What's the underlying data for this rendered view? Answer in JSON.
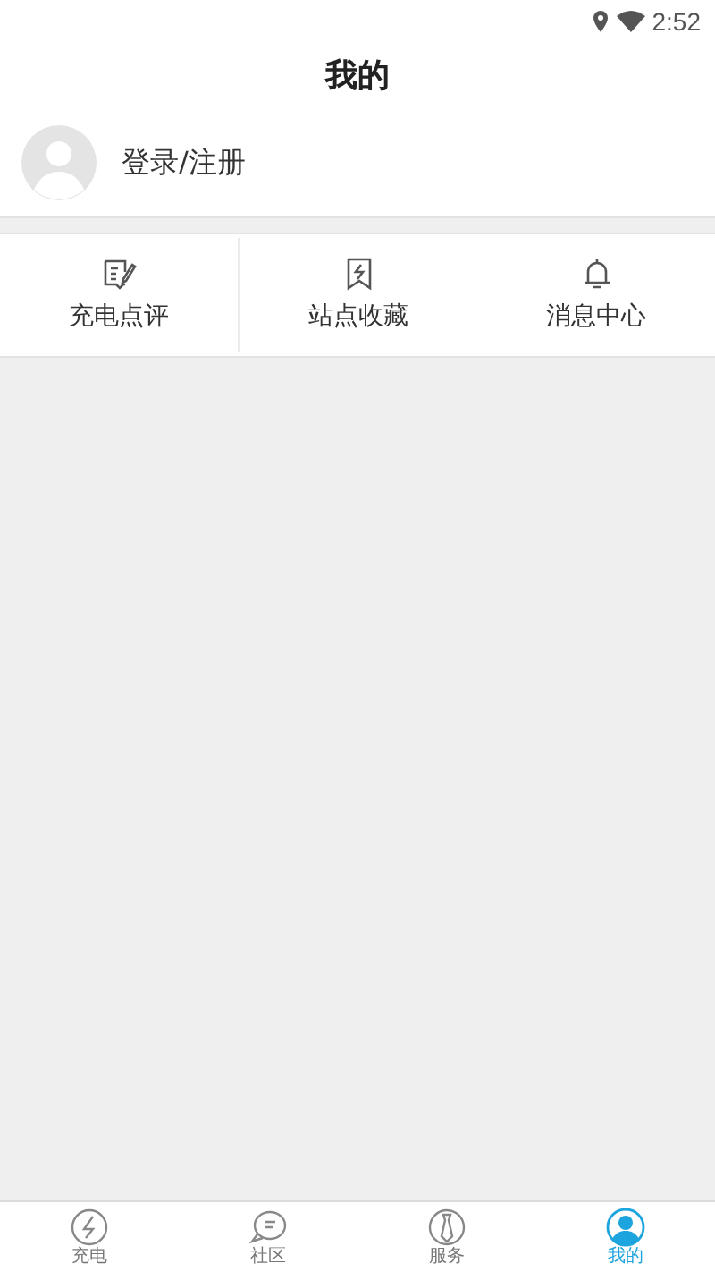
{
  "status_bar": {
    "time": "2:52"
  },
  "header": {
    "title": "我的"
  },
  "profile": {
    "login_label": "登录/注册"
  },
  "shortcuts": [
    {
      "kind": "review",
      "label": "充电点评"
    },
    {
      "kind": "bookmark",
      "label": "站点收藏"
    },
    {
      "kind": "bell",
      "label": "消息中心"
    }
  ],
  "bottom_nav": [
    {
      "kind": "bolt",
      "label": "充电",
      "selected": false
    },
    {
      "kind": "chat",
      "label": "社区",
      "selected": false
    },
    {
      "kind": "tie",
      "label": "服务",
      "selected": false
    },
    {
      "kind": "person",
      "label": "我的",
      "selected": true
    }
  ]
}
